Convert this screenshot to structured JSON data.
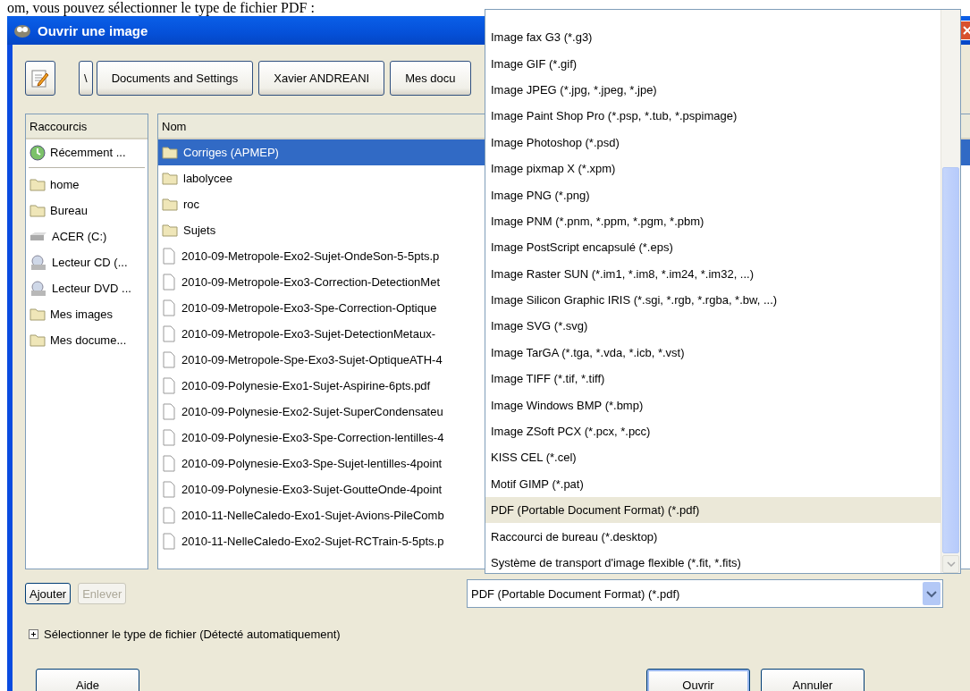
{
  "caption": "om, vous pouvez sélectionner le type de fichier PDF :",
  "window": {
    "title": "Ouvrir une image"
  },
  "path_bar": [
    "\\",
    "Documents and Settings",
    "Xavier ANDREANI",
    "Mes docu"
  ],
  "shortcuts": {
    "header": "Raccourcis",
    "items": [
      {
        "label": "Récemment ...",
        "kind": "recent",
        "selected": false
      },
      {
        "label": "home",
        "kind": "folder",
        "selected": false
      },
      {
        "label": "Bureau",
        "kind": "folder",
        "selected": false
      },
      {
        "label": "ACER (C:)",
        "kind": "drive",
        "selected": false
      },
      {
        "label": "Lecteur CD (...",
        "kind": "cd",
        "selected": false
      },
      {
        "label": "Lecteur DVD ...",
        "kind": "dvd",
        "selected": false
      },
      {
        "label": "Mes images",
        "kind": "folder",
        "selected": false
      },
      {
        "label": "Mes docume...",
        "kind": "folder",
        "selected": false
      }
    ]
  },
  "files": {
    "header": "Nom",
    "rows": [
      {
        "name": "Corriges (APMEP)",
        "kind": "folder",
        "selected": true
      },
      {
        "name": "labolycee",
        "kind": "folder",
        "selected": false
      },
      {
        "name": "roc",
        "kind": "folder",
        "selected": false
      },
      {
        "name": "Sujets",
        "kind": "folder",
        "selected": false
      },
      {
        "name": "2010-09-Metropole-Exo2-Sujet-OndeSon-5-5pts.p",
        "kind": "file",
        "selected": false
      },
      {
        "name": "2010-09-Metropole-Exo3-Correction-DetectionMet",
        "kind": "file",
        "selected": false
      },
      {
        "name": "2010-09-Metropole-Exo3-Spe-Correction-Optique",
        "kind": "file",
        "selected": false
      },
      {
        "name": "2010-09-Metropole-Exo3-Sujet-DetectionMetaux-",
        "kind": "file",
        "selected": false
      },
      {
        "name": "2010-09-Metropole-Spe-Exo3-Sujet-OptiqueATH-4",
        "kind": "file",
        "selected": false
      },
      {
        "name": "2010-09-Polynesie-Exo1-Sujet-Aspirine-6pts.pdf",
        "kind": "file",
        "selected": false
      },
      {
        "name": "2010-09-Polynesie-Exo2-Sujet-SuperCondensateu",
        "kind": "file",
        "selected": false
      },
      {
        "name": "2010-09-Polynesie-Exo3-Spe-Correction-lentilles-4",
        "kind": "file",
        "selected": false
      },
      {
        "name": "2010-09-Polynesie-Exo3-Spe-Sujet-lentilles-4point",
        "kind": "file",
        "selected": false
      },
      {
        "name": "2010-09-Polynesie-Exo3-Sujet-GoutteOnde-4point",
        "kind": "file",
        "selected": false
      },
      {
        "name": "2010-11-NelleCaledo-Exo1-Sujet-Avions-PileComb",
        "kind": "file",
        "selected": false
      },
      {
        "name": "2010-11-NelleCaledo-Exo2-Sujet-RCTrain-5-5pts.p",
        "kind": "file",
        "selected": false
      }
    ]
  },
  "list_buttons": [
    {
      "label": "Ajouter",
      "disabled": false
    },
    {
      "label": "Enlever",
      "disabled": true
    }
  ],
  "file_type": {
    "value": "PDF (Portable Document Format) (*.pdf)",
    "options": [
      {
        "label": "Image fax G3 (*.g3)",
        "selected": false
      },
      {
        "label": "Image GIF (*.gif)",
        "selected": false
      },
      {
        "label": "Image JPEG (*.jpg, *.jpeg, *.jpe)",
        "selected": false
      },
      {
        "label": "Image Paint Shop Pro (*.psp, *.tub, *.pspimage)",
        "selected": false
      },
      {
        "label": "Image Photoshop (*.psd)",
        "selected": false
      },
      {
        "label": "Image pixmap X (*.xpm)",
        "selected": false
      },
      {
        "label": "Image PNG (*.png)",
        "selected": false
      },
      {
        "label": "Image PNM (*.pnm, *.ppm, *.pgm, *.pbm)",
        "selected": false
      },
      {
        "label": "Image PostScript encapsulé (*.eps)",
        "selected": false
      },
      {
        "label": "Image Raster SUN (*.im1, *.im8, *.im24, *.im32, ...)",
        "selected": false
      },
      {
        "label": "Image Silicon Graphic IRIS (*.sgi, *.rgb, *.rgba, *.bw, ...)",
        "selected": false
      },
      {
        "label": "Image SVG (*.svg)",
        "selected": false
      },
      {
        "label": "Image TarGA (*.tga, *.vda, *.icb, *.vst)",
        "selected": false
      },
      {
        "label": "Image TIFF (*.tif, *.tiff)",
        "selected": false
      },
      {
        "label": "Image Windows BMP (*.bmp)",
        "selected": false
      },
      {
        "label": "Image ZSoft PCX (*.pcx, *.pcc)",
        "selected": false
      },
      {
        "label": "KISS CEL (*.cel)",
        "selected": false
      },
      {
        "label": "Motif GIMP (*.pat)",
        "selected": false
      },
      {
        "label": "PDF (Portable Document Format) (*.pdf)",
        "selected": true
      },
      {
        "label": "Raccourci de bureau (*.desktop)",
        "selected": false
      },
      {
        "label": "Système de transport d'image flexible (*.fit, *.fits)",
        "selected": false
      }
    ]
  },
  "expander": {
    "label": "Sélectionner le type de fichier (Détecté automatiquement)",
    "expanded": false
  },
  "actions": [
    {
      "label": "Aide",
      "default": false
    },
    {
      "label": "Ouvrir",
      "default": true
    },
    {
      "label": "Annuler",
      "default": false
    }
  ]
}
